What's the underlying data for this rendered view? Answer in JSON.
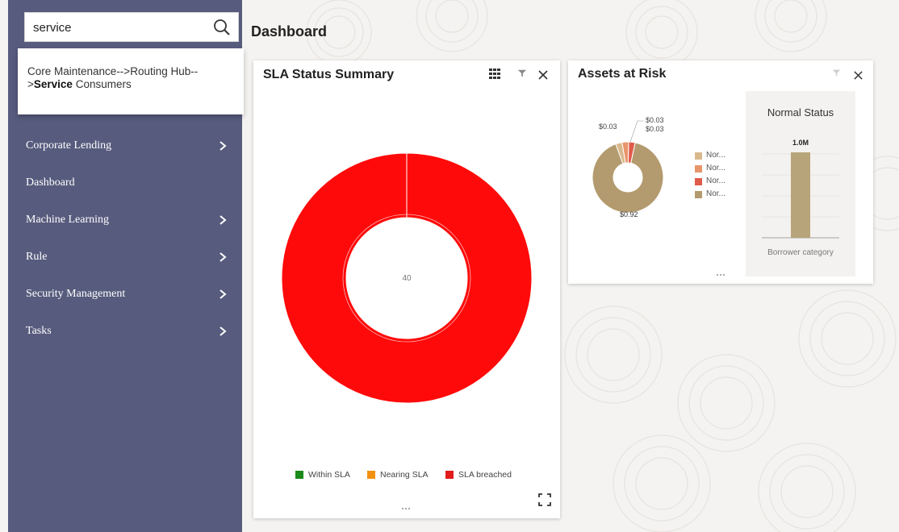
{
  "search": {
    "value": "service"
  },
  "suggestion": {
    "path_prefix": "Core Maintenance-->Routing Hub-->",
    "highlight": "Service",
    "suffix": " Consumers"
  },
  "sidebar": {
    "items": [
      {
        "label": "Corporate Lending",
        "has_children": true
      },
      {
        "label": "Dashboard",
        "has_children": false
      },
      {
        "label": "Machine Learning",
        "has_children": true
      },
      {
        "label": "Rule",
        "has_children": true
      },
      {
        "label": "Security Management",
        "has_children": true
      },
      {
        "label": "Tasks",
        "has_children": true
      }
    ]
  },
  "page_title": "Dashboard",
  "sla_widget": {
    "title": "SLA Status Summary",
    "icons": [
      "grid-icon",
      "filter-icon",
      "close-icon",
      "expand-icon",
      "drag-handle-icon"
    ],
    "center_label": "40",
    "legend": [
      {
        "label": "Within SLA",
        "color": "#1a8a1a"
      },
      {
        "label": "Nearing SLA",
        "color": "#f29111"
      },
      {
        "label": "SLA breached",
        "color": "#e21b1b"
      }
    ]
  },
  "assets_widget": {
    "title": "Assets at Risk",
    "icons": [
      "filter-icon",
      "close-icon",
      "drag-handle-icon"
    ],
    "donut_labels": [
      "$0.03",
      "$0.03",
      "$0.03",
      "$0.92"
    ],
    "legend": [
      {
        "label": "Nor...",
        "color": "#d9b98c"
      },
      {
        "label": "Nor...",
        "color": "#e8956b"
      },
      {
        "label": "Nor...",
        "color": "#e05b4a"
      },
      {
        "label": "Nor...",
        "color": "#b39b6f"
      }
    ],
    "normal_status": {
      "title": "Normal Status",
      "value_label": "1.0M",
      "xlabel": "Borrower category",
      "bar_color": "#b8a47a"
    }
  },
  "colors": {
    "sidebar_bg": "#575c7e",
    "sla_breached": "#ff0a0a"
  },
  "chart_data": [
    {
      "type": "pie",
      "title": "SLA Status Summary",
      "categories": [
        "Within SLA",
        "Nearing SLA",
        "SLA breached"
      ],
      "values": [
        0,
        0,
        40
      ],
      "center_label": "40",
      "legend": "bottom"
    },
    {
      "type": "pie",
      "title": "Assets at Risk",
      "categories": [
        "Nor...",
        "Nor...",
        "Nor...",
        "Nor..."
      ],
      "values": [
        0.03,
        0.03,
        0.03,
        0.92
      ],
      "legend": "right"
    },
    {
      "type": "bar",
      "title": "Normal Status",
      "categories": [
        "Borrower category"
      ],
      "values": [
        1.0
      ],
      "data_labels": [
        "1.0M"
      ],
      "xlabel": "Borrower category"
    }
  ]
}
